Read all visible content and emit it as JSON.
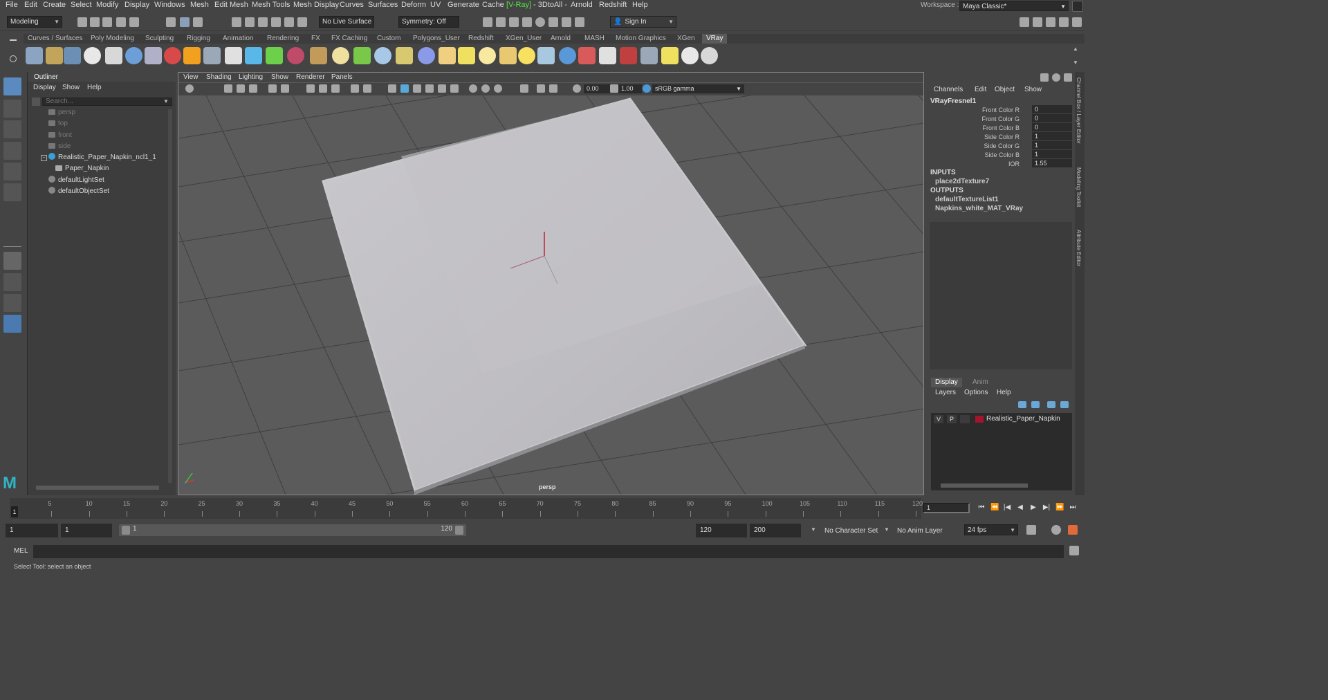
{
  "menubar": {
    "items": [
      "File",
      "Edit",
      "Create",
      "Select",
      "Modify",
      "Display",
      "Windows",
      "Mesh",
      "Edit Mesh",
      "Mesh Tools",
      "Mesh Display",
      "Curves",
      "Surfaces",
      "Deform",
      "UV",
      "Generate",
      "Cache",
      "[V-Ray]",
      "- 3DtoAll -",
      "Arnold",
      "Redshift",
      "Help"
    ],
    "workspace_label": "Workspace :",
    "workspace_value": "Maya Classic*"
  },
  "statusline": {
    "mode": "Modeling",
    "live_surface": "No Live Surface",
    "symmetry": "Symmetry: Off",
    "sign_in": "Sign In"
  },
  "shelf": {
    "tabs": [
      "Curves / Surfaces",
      "Poly Modeling",
      "Sculpting",
      "Rigging",
      "Animation",
      "Rendering",
      "FX",
      "FX Caching",
      "Custom",
      "Polygons_User",
      "Redshift",
      "XGen_User",
      "Arnold",
      "MASH",
      "Motion Graphics",
      "XGen",
      "VRay"
    ],
    "active_tab": "VRay"
  },
  "outliner": {
    "title": "Outliner",
    "menu": [
      "Display",
      "Show",
      "Help"
    ],
    "search_placeholder": "Search...",
    "items": [
      {
        "label": "persp",
        "dim": true,
        "icon": "camera-icon"
      },
      {
        "label": "top",
        "dim": true,
        "icon": "camera-icon"
      },
      {
        "label": "front",
        "dim": true,
        "icon": "camera-icon"
      },
      {
        "label": "side",
        "dim": true,
        "icon": "camera-icon"
      },
      {
        "label": "Realistic_Paper_Napkin_ncl1_1",
        "dim": false,
        "icon": "group-icon"
      },
      {
        "label": "Paper_Napkin",
        "dim": false,
        "icon": "mesh-icon"
      },
      {
        "label": "defaultLightSet",
        "dim": false,
        "icon": "set-icon"
      },
      {
        "label": "defaultObjectSet",
        "dim": false,
        "icon": "set-icon"
      }
    ]
  },
  "viewport": {
    "menu": [
      "View",
      "Shading",
      "Lighting",
      "Show",
      "Renderer",
      "Panels"
    ],
    "exposure": "0.00",
    "gamma": "1.00",
    "color_space": "sRGB gamma",
    "camera_label": "persp"
  },
  "channelbox": {
    "menu": [
      "Channels",
      "Edit",
      "Object",
      "Show"
    ],
    "node": "VRayFresnel1",
    "attrs": [
      {
        "label": "Front Color R",
        "value": "0"
      },
      {
        "label": "Front Color G",
        "value": "0"
      },
      {
        "label": "Front Color B",
        "value": "0"
      },
      {
        "label": "Side Color R",
        "value": "1"
      },
      {
        "label": "Side Color G",
        "value": "1"
      },
      {
        "label": "Side Color B",
        "value": "1"
      },
      {
        "label": "IOR",
        "value": "1.55"
      }
    ],
    "inputs_header": "INPUTS",
    "inputs": [
      "place2dTexture7"
    ],
    "outputs_header": "OUTPUTS",
    "outputs": [
      "defaultTextureList1",
      "Napkins_white_MAT_VRay"
    ]
  },
  "layers": {
    "tabs": [
      "Display",
      "Anim"
    ],
    "menu": [
      "Layers",
      "Options",
      "Help"
    ],
    "row": {
      "v": "V",
      "p": "P",
      "name": "Realistic_Paper_Napkin",
      "color": "#a3152c"
    }
  },
  "side_tabs": [
    "Channel Box / Layer Editor",
    "Modeling Toolkit",
    "Attribute Editor"
  ],
  "timeslider": {
    "ticks": [
      "5",
      "10",
      "15",
      "20",
      "25",
      "30",
      "35",
      "40",
      "45",
      "50",
      "55",
      "60",
      "65",
      "70",
      "75",
      "80",
      "85",
      "90",
      "95",
      "100",
      "105",
      "110",
      "115",
      "120"
    ],
    "current_frame": "1",
    "frame_field": "1"
  },
  "range": {
    "start": "1",
    "playback_start": "1",
    "slider_start": "1",
    "slider_end": "120",
    "playback_end": "120",
    "end": "200",
    "character_set": "No Character Set",
    "anim_layer": "No Anim Layer",
    "fps": "24 fps"
  },
  "cmdline": {
    "label": "MEL"
  },
  "helpline": {
    "text": "Select Tool: select an object"
  },
  "colors": {
    "bg": "#444444",
    "panel": "#3d3d3d",
    "field": "#2b2b2b",
    "vray_green": "#55e046",
    "layer_red": "#a3152c"
  }
}
